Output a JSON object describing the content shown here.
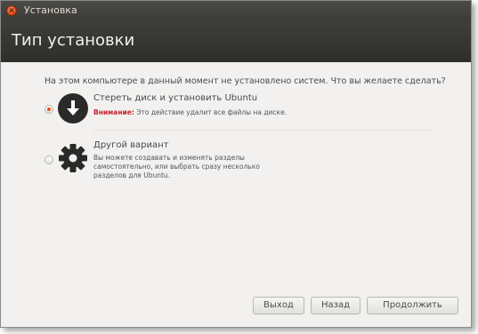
{
  "window": {
    "title": "Установка",
    "close_symbol": "×"
  },
  "header": {
    "title": "Тип установки"
  },
  "question": "На этом компьютере в данный момент не установлено систем. Что вы желаете сделать?",
  "options": [
    {
      "title": "Стереть диск и установить Ubuntu",
      "warning_label": "Внимание:",
      "warning_text": "Это действие удалит все файлы на диске.",
      "selected": true,
      "icon": "download-arrow-icon"
    },
    {
      "title": "Другой вариант",
      "description": "Вы можете создавать и изменять разделы самостоятельно, или выбрать сразу несколько разделов для Ubuntu.",
      "selected": false,
      "icon": "gear-icon"
    }
  ],
  "buttons": {
    "quit": "Выход",
    "back": "Назад",
    "continue": "Продолжить"
  },
  "colors": {
    "header_bg": "#3c3b37",
    "accent": "#e5541e",
    "warning": "#c6262e"
  }
}
